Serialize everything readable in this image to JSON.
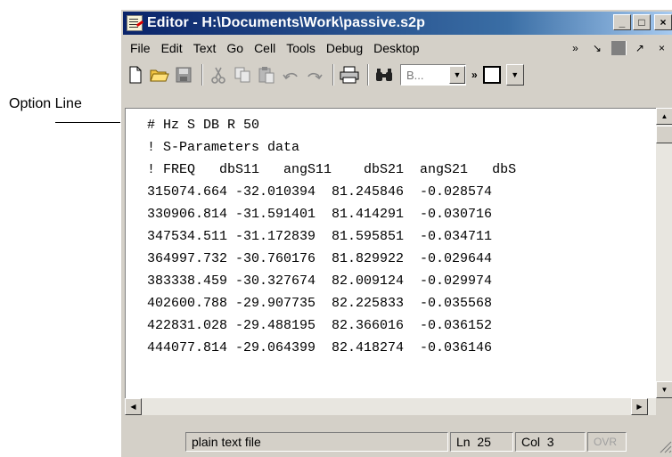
{
  "annotation": {
    "label": "Option Line"
  },
  "window": {
    "title": "Editor - H:\\Documents\\Work\\passive.s2p",
    "buttons": {
      "minimize": "_",
      "maximize": "□",
      "close": "×"
    }
  },
  "menu": {
    "items": [
      "File",
      "Edit",
      "Text",
      "Go",
      "Cell",
      "Tools",
      "Debug",
      "Desktop"
    ],
    "right": [
      "»",
      "↘",
      "↗",
      "×"
    ]
  },
  "toolbar": {
    "combo_value": "B...",
    "more": "»"
  },
  "editor": {
    "lines": [
      "# Hz S DB R 50",
      "! S-Parameters data",
      "! FREQ   dbS11   angS11    dbS21  angS21   dbS",
      "315074.664 -32.010394  81.245846  -0.028574",
      "330906.814 -31.591401  81.414291  -0.030716",
      "347534.511 -31.172839  81.595851  -0.034711",
      "364997.732 -30.760176  81.829922  -0.029644",
      "383338.459 -30.327674  82.009124  -0.029974",
      "402600.788 -29.907735  82.225833  -0.035568",
      "422831.028 -29.488195  82.366016  -0.036152",
      "444077.814 -29.064399  82.418274  -0.036146"
    ]
  },
  "status": {
    "file_type": "plain text file",
    "ln_label": "Ln",
    "ln_value": "25",
    "col_label": "Col",
    "col_value": "3",
    "ovr": "OVR"
  },
  "colors": {
    "title_bar": "#0a246a",
    "window_face": "#d4d0c8"
  }
}
